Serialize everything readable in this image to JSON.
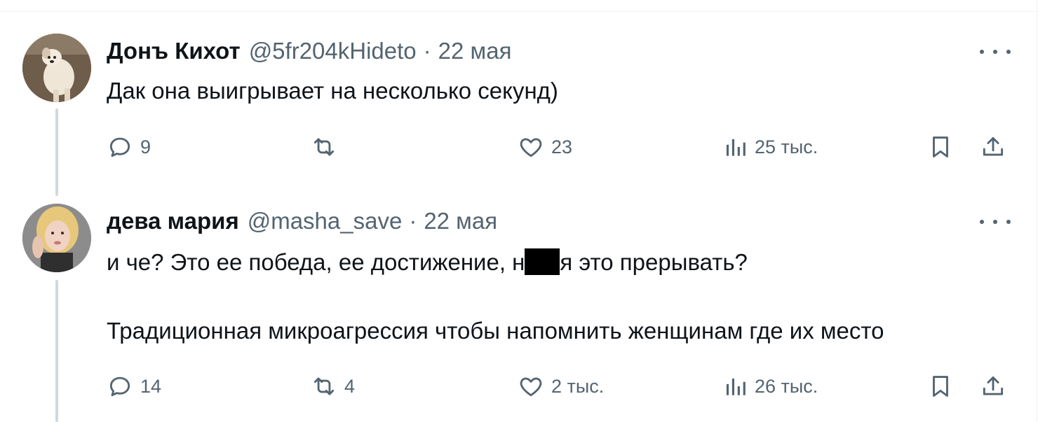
{
  "tweets": [
    {
      "display_name": "Донъ Кихот",
      "handle": "@5fr204kHideto",
      "separator": "·",
      "date": "22 мая",
      "lines": [
        "Дак она выигрывает на несколько секунд)"
      ],
      "actions": {
        "reply_count": "9",
        "retweet_count": "",
        "like_count": "23",
        "views_count": "25 тыс."
      },
      "avatar_icon": "dog-avatar"
    },
    {
      "display_name": "дева мария",
      "handle": "@masha_save",
      "separator": "·",
      "date": "22 мая",
      "line1_before": "и че? Это ее победа, ее достижение, н",
      "line1_after": "я это прерывать?",
      "line2": "Традиционная микроагрессия чтобы напомнить женщинам где их место",
      "actions": {
        "reply_count": "14",
        "retweet_count": "4",
        "like_count": "2 тыс.",
        "views_count": "26 тыс."
      },
      "avatar_icon": "woman-avatar"
    }
  ],
  "icons": {
    "reply": "speech-bubble-icon",
    "retweet": "retweet-arrows-icon",
    "like": "heart-icon",
    "views": "bar-chart-icon",
    "bookmark": "bookmark-icon",
    "share": "share-upload-icon",
    "more": "more-dots-icon"
  },
  "colors": {
    "text_primary": "#0f1419",
    "text_secondary": "#536471",
    "thread_line": "#cfd9de",
    "divider": "#eff3f4",
    "censor_bar": "#000000"
  }
}
